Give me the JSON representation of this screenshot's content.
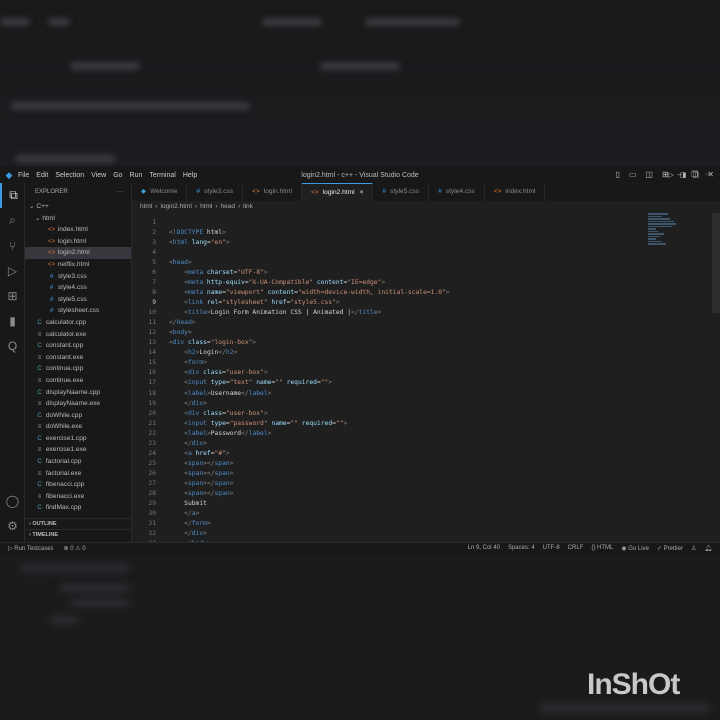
{
  "window": {
    "title": "login2.html - c++ - Visual Studio Code"
  },
  "menu": [
    "File",
    "Edit",
    "Selection",
    "View",
    "Go",
    "Run",
    "Terminal",
    "Help"
  ],
  "sidebar": {
    "header": "EXPLORER",
    "more": "···",
    "root": "C++",
    "folder": "html",
    "items": [
      {
        "name": "index.html",
        "type": "html",
        "indent": 2
      },
      {
        "name": "login.html",
        "type": "html",
        "indent": 2
      },
      {
        "name": "login2.html",
        "type": "html",
        "indent": 2,
        "selected": true
      },
      {
        "name": "netflix.html",
        "type": "html",
        "indent": 2
      },
      {
        "name": "style3.css",
        "type": "css",
        "indent": 2
      },
      {
        "name": "style4.css",
        "type": "css",
        "indent": 2
      },
      {
        "name": "style5.css",
        "type": "css",
        "indent": 2
      },
      {
        "name": "stylesheet.css",
        "type": "css",
        "indent": 2
      },
      {
        "name": "calculator.cpp",
        "type": "cpp",
        "indent": 1
      },
      {
        "name": "calculator.exe",
        "type": "exe",
        "indent": 1
      },
      {
        "name": "constant.cpp",
        "type": "cpp",
        "indent": 1
      },
      {
        "name": "constant.exe",
        "type": "exe",
        "indent": 1
      },
      {
        "name": "continue.cpp",
        "type": "cpp",
        "indent": 1
      },
      {
        "name": "continue.exe",
        "type": "exe",
        "indent": 1
      },
      {
        "name": "displayNaame.cpp",
        "type": "cpp",
        "indent": 1
      },
      {
        "name": "displayNaame.exe",
        "type": "exe",
        "indent": 1
      },
      {
        "name": "doWhile.cpp",
        "type": "cpp",
        "indent": 1
      },
      {
        "name": "doWhile.exe",
        "type": "exe",
        "indent": 1
      },
      {
        "name": "exercise1.cpp",
        "type": "cpp",
        "indent": 1
      },
      {
        "name": "exercise1.exe",
        "type": "exe",
        "indent": 1
      },
      {
        "name": "factorial.cpp",
        "type": "cpp",
        "indent": 1
      },
      {
        "name": "factorial.exe",
        "type": "exe",
        "indent": 1
      },
      {
        "name": "fibenacci.cpp",
        "type": "cpp",
        "indent": 1
      },
      {
        "name": "fibenacci.exe",
        "type": "exe",
        "indent": 1
      },
      {
        "name": "findMax.cpp",
        "type": "cpp",
        "indent": 1
      }
    ],
    "outline": "OUTLINE",
    "timeline": "TIMELINE"
  },
  "tabs": [
    {
      "label": "Welcome",
      "icon": "vscode"
    },
    {
      "label": "style3.css",
      "icon": "#"
    },
    {
      "label": "login.html",
      "icon": "<>"
    },
    {
      "label": "login2.html",
      "icon": "<>",
      "active": true,
      "close": "×"
    },
    {
      "label": "style5.css",
      "icon": "#"
    },
    {
      "label": "style4.css",
      "icon": "#"
    },
    {
      "label": "index.html",
      "icon": "<>"
    }
  ],
  "breadcrumb": [
    "html",
    "login2.html",
    "html",
    "head",
    "link"
  ],
  "editor": {
    "current_line": 9,
    "lines": [
      [],
      [
        [
          "p",
          "<!"
        ],
        [
          "t",
          "DOCTYPE"
        ],
        [
          "x",
          " html"
        ],
        [
          "p",
          ">"
        ]
      ],
      [
        [
          "p",
          "<"
        ],
        [
          "t",
          "html"
        ],
        [
          "a",
          " lang"
        ],
        [
          "x",
          "="
        ],
        [
          "s",
          "\"en\""
        ],
        [
          "p",
          ">"
        ]
      ],
      [],
      [
        [
          "p",
          "<"
        ],
        [
          "t",
          "head"
        ],
        [
          "p",
          ">"
        ]
      ],
      [
        [
          "x",
          "    "
        ],
        [
          "p",
          "<"
        ],
        [
          "t",
          "meta"
        ],
        [
          "a",
          " charset"
        ],
        [
          "x",
          "="
        ],
        [
          "s",
          "\"UTF-8\""
        ],
        [
          "p",
          ">"
        ]
      ],
      [
        [
          "x",
          "    "
        ],
        [
          "p",
          "<"
        ],
        [
          "t",
          "meta"
        ],
        [
          "a",
          " http-equiv"
        ],
        [
          "x",
          "="
        ],
        [
          "s",
          "\"X-UA-Compatible\""
        ],
        [
          "a",
          " content"
        ],
        [
          "x",
          "="
        ],
        [
          "s",
          "\"IE=edge\""
        ],
        [
          "p",
          ">"
        ]
      ],
      [
        [
          "x",
          "    "
        ],
        [
          "p",
          "<"
        ],
        [
          "t",
          "meta"
        ],
        [
          "a",
          " name"
        ],
        [
          "x",
          "="
        ],
        [
          "s",
          "\"viewport\""
        ],
        [
          "a",
          " content"
        ],
        [
          "x",
          "="
        ],
        [
          "s",
          "\"width=device-width, initial-scale=1.0\""
        ],
        [
          "p",
          ">"
        ]
      ],
      [
        [
          "x",
          "    "
        ],
        [
          "p",
          "<"
        ],
        [
          "t",
          "link"
        ],
        [
          "a",
          " rel"
        ],
        [
          "x",
          "="
        ],
        [
          "s",
          "\"stylesheet\""
        ],
        [
          "a",
          " href"
        ],
        [
          "x",
          "="
        ],
        [
          "s",
          "\"style5.css\""
        ],
        [
          "p",
          ">"
        ]
      ],
      [
        [
          "x",
          "    "
        ],
        [
          "p",
          "<"
        ],
        [
          "t",
          "title"
        ],
        [
          "p",
          ">"
        ],
        [
          "x",
          "Login Form Animation CSS | Animated |"
        ],
        [
          "p",
          "</"
        ],
        [
          "t",
          "title"
        ],
        [
          "p",
          ">"
        ]
      ],
      [
        [
          "p",
          "</"
        ],
        [
          "t",
          "head"
        ],
        [
          "p",
          ">"
        ]
      ],
      [
        [
          "p",
          "<"
        ],
        [
          "t",
          "body"
        ],
        [
          "p",
          ">"
        ]
      ],
      [
        [
          "p",
          "<"
        ],
        [
          "t",
          "div"
        ],
        [
          "a",
          " class"
        ],
        [
          "x",
          "="
        ],
        [
          "s",
          "\"login-box\""
        ],
        [
          "p",
          ">"
        ]
      ],
      [
        [
          "x",
          "    "
        ],
        [
          "p",
          "<"
        ],
        [
          "t",
          "h2"
        ],
        [
          "p",
          ">"
        ],
        [
          "x",
          "Login"
        ],
        [
          "p",
          "</"
        ],
        [
          "t",
          "h2"
        ],
        [
          "p",
          ">"
        ]
      ],
      [
        [
          "x",
          "    "
        ],
        [
          "p",
          "<"
        ],
        [
          "t",
          "form"
        ],
        [
          "p",
          ">"
        ]
      ],
      [
        [
          "x",
          "    "
        ],
        [
          "p",
          "<"
        ],
        [
          "t",
          "div"
        ],
        [
          "a",
          " class"
        ],
        [
          "x",
          "="
        ],
        [
          "s",
          "\"user-box\""
        ],
        [
          "p",
          ">"
        ]
      ],
      [
        [
          "x",
          "    "
        ],
        [
          "p",
          "<"
        ],
        [
          "t",
          "input"
        ],
        [
          "a",
          " type"
        ],
        [
          "x",
          "="
        ],
        [
          "s",
          "\"text\""
        ],
        [
          "a",
          " name"
        ],
        [
          "x",
          "="
        ],
        [
          "s",
          "\"\""
        ],
        [
          "a",
          " required"
        ],
        [
          "x",
          "="
        ],
        [
          "s",
          "\"\""
        ],
        [
          "p",
          ">"
        ]
      ],
      [
        [
          "x",
          "    "
        ],
        [
          "p",
          "<"
        ],
        [
          "t",
          "label"
        ],
        [
          "p",
          ">"
        ],
        [
          "x",
          "Username"
        ],
        [
          "p",
          "</"
        ],
        [
          "t",
          "label"
        ],
        [
          "p",
          ">"
        ]
      ],
      [
        [
          "x",
          "    "
        ],
        [
          "p",
          "</"
        ],
        [
          "t",
          "div"
        ],
        [
          "p",
          ">"
        ]
      ],
      [
        [
          "x",
          "    "
        ],
        [
          "p",
          "<"
        ],
        [
          "t",
          "div"
        ],
        [
          "a",
          " class"
        ],
        [
          "x",
          "="
        ],
        [
          "s",
          "\"user-box\""
        ],
        [
          "p",
          ">"
        ]
      ],
      [
        [
          "x",
          "    "
        ],
        [
          "p",
          "<"
        ],
        [
          "t",
          "input"
        ],
        [
          "a",
          " type"
        ],
        [
          "x",
          "="
        ],
        [
          "s",
          "\"password\""
        ],
        [
          "a",
          " name"
        ],
        [
          "x",
          "="
        ],
        [
          "s",
          "\"\""
        ],
        [
          "a",
          " required"
        ],
        [
          "x",
          "="
        ],
        [
          "s",
          "\"\""
        ],
        [
          "p",
          ">"
        ]
      ],
      [
        [
          "x",
          "    "
        ],
        [
          "p",
          "<"
        ],
        [
          "t",
          "label"
        ],
        [
          "p",
          ">"
        ],
        [
          "x",
          "Password"
        ],
        [
          "p",
          "</"
        ],
        [
          "t",
          "label"
        ],
        [
          "p",
          ">"
        ]
      ],
      [
        [
          "x",
          "    "
        ],
        [
          "p",
          "</"
        ],
        [
          "t",
          "div"
        ],
        [
          "p",
          ">"
        ]
      ],
      [
        [
          "x",
          "    "
        ],
        [
          "p",
          "<"
        ],
        [
          "t",
          "a"
        ],
        [
          "a",
          " href"
        ],
        [
          "x",
          "="
        ],
        [
          "s",
          "\"#\""
        ],
        [
          "p",
          ">"
        ]
      ],
      [
        [
          "x",
          "    "
        ],
        [
          "p",
          "<"
        ],
        [
          "t",
          "span"
        ],
        [
          "p",
          "></"
        ],
        [
          "t",
          "span"
        ],
        [
          "p",
          ">"
        ]
      ],
      [
        [
          "x",
          "    "
        ],
        [
          "p",
          "<"
        ],
        [
          "t",
          "span"
        ],
        [
          "p",
          "></"
        ],
        [
          "t",
          "span"
        ],
        [
          "p",
          ">"
        ]
      ],
      [
        [
          "x",
          "    "
        ],
        [
          "p",
          "<"
        ],
        [
          "t",
          "span"
        ],
        [
          "p",
          "></"
        ],
        [
          "t",
          "span"
        ],
        [
          "p",
          ">"
        ]
      ],
      [
        [
          "x",
          "    "
        ],
        [
          "p",
          "<"
        ],
        [
          "t",
          "span"
        ],
        [
          "p",
          "></"
        ],
        [
          "t",
          "span"
        ],
        [
          "p",
          ">"
        ]
      ],
      [
        [
          "x",
          "    Submit"
        ]
      ],
      [
        [
          "x",
          "    "
        ],
        [
          "p",
          "</"
        ],
        [
          "t",
          "a"
        ],
        [
          "p",
          ">"
        ]
      ],
      [
        [
          "x",
          "    "
        ],
        [
          "p",
          "</"
        ],
        [
          "t",
          "form"
        ],
        [
          "p",
          ">"
        ]
      ],
      [
        [
          "x",
          "    "
        ],
        [
          "p",
          "</"
        ],
        [
          "t",
          "div"
        ],
        [
          "p",
          ">"
        ]
      ],
      [
        [
          "x",
          "    "
        ],
        [
          "p",
          "</"
        ],
        [
          "t",
          "body"
        ],
        [
          "p",
          ">"
        ]
      ]
    ]
  },
  "status": {
    "run": "Run Testcases",
    "problems": "⊗ 0 ⚠ 0",
    "position": "Ln 9, Col 40",
    "spaces": "Spaces: 4",
    "encoding": "UTF-8",
    "eol": "CRLF",
    "language": "{} HTML",
    "golive": "Go Live",
    "prettier": "✓ Prettier"
  },
  "watermark": "InShOt",
  "colors": {
    "accent": "#3a9be0",
    "bg": "#1f1f1f",
    "sidebar": "#181818"
  }
}
